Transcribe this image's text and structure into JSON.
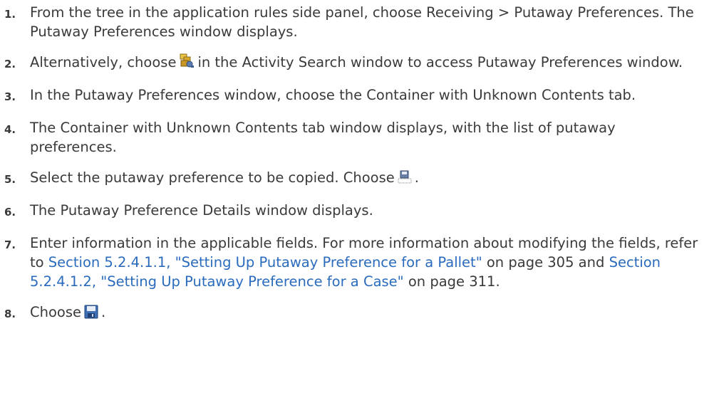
{
  "steps": [
    {
      "number": "1.",
      "text": "From the tree in the application rules side panel, choose Receiving > Putaway Preferences. The Putaway Preferences window displays."
    },
    {
      "number": "2.",
      "before": "Alternatively, choose",
      "icon": "activity-search-putaway-icon",
      "after": "in the Activity Search window to access Putaway Preferences window."
    },
    {
      "number": "3.",
      "text": "In the Putaway Preferences window, choose the Container with Unknown Contents tab."
    },
    {
      "number": "4.",
      "text": "The Container with Unknown Contents tab window displays, with the list of putaway preferences."
    },
    {
      "number": "5.",
      "before": "Select the putaway preference to be copied. Choose",
      "icon": "copy-save-icon",
      "after": "."
    },
    {
      "number": "6.",
      "text": "The Putaway Preference Details window displays."
    },
    {
      "number": "7.",
      "text1": "Enter information in the applicable fields. For more information about modifying the fields, refer to",
      "link1": "Section 5.2.4.1.1, \"Setting Up Putaway Preference for a Pallet\"",
      "text2": "on page 305 and",
      "link2": "Section 5.2.4.1.2, \"Setting Up Putaway Preference for a Case\"",
      "text3": "on page 311."
    },
    {
      "number": "8.",
      "before": "Choose",
      "icon": "save-icon",
      "after": "."
    }
  ]
}
